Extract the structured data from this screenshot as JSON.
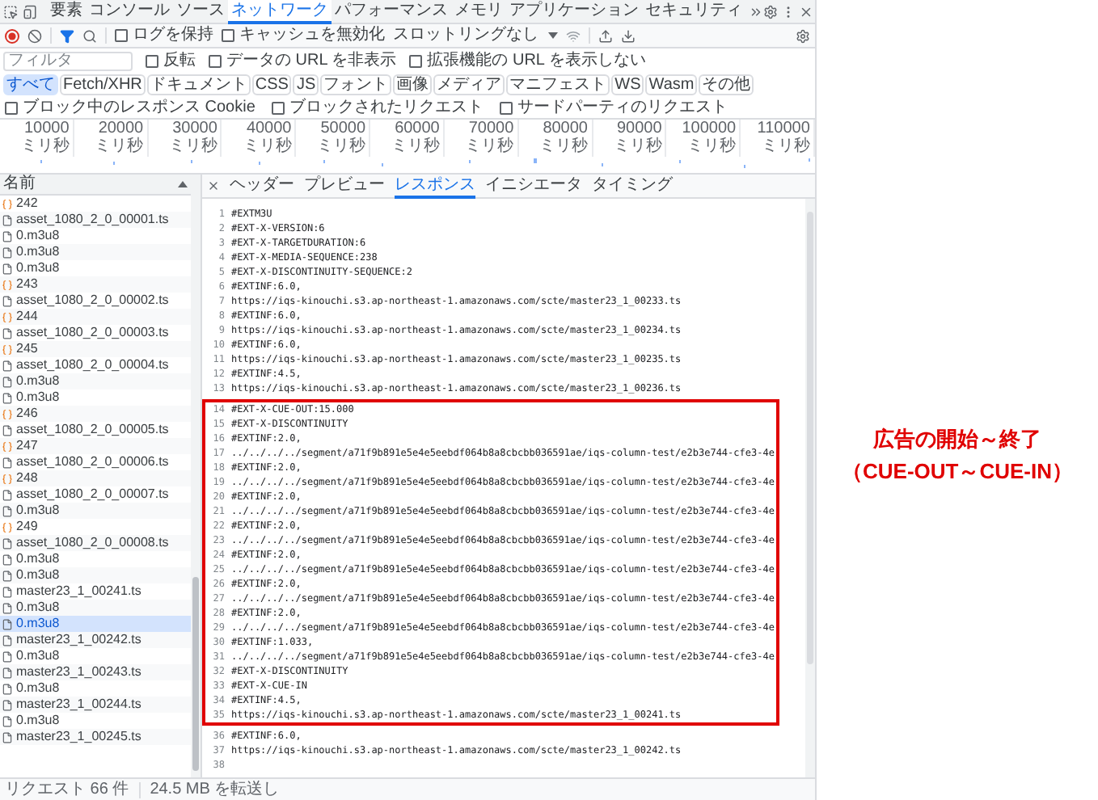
{
  "devtools_tabs": [
    {
      "label": "要素",
      "selected": false
    },
    {
      "label": "コンソール",
      "selected": false
    },
    {
      "label": "ソース",
      "selected": false
    },
    {
      "label": "ネットワーク",
      "selected": true
    },
    {
      "label": "パフォーマンス",
      "selected": false
    },
    {
      "label": "メモリ",
      "selected": false
    },
    {
      "label": "アプリケーション",
      "selected": false
    },
    {
      "label": "セキュリティ",
      "selected": false
    }
  ],
  "toolbar": {
    "checkboxes": [
      {
        "label": "ログを保持",
        "checked": false
      },
      {
        "label": "キャッシュを無効化",
        "checked": false
      }
    ],
    "throttling": "スロットリングなし"
  },
  "filter": {
    "placeholder": "フィルタ",
    "checkboxes": [
      {
        "label": "反転",
        "checked": false
      },
      {
        "label": "データの URL を非表示",
        "checked": false
      },
      {
        "label": "拡張機能の URL を表示しない",
        "checked": false
      }
    ]
  },
  "type_filters": [
    {
      "label": "すべて",
      "selected": true
    },
    {
      "label": "Fetch/XHR",
      "selected": false
    },
    {
      "label": "ドキュメント",
      "selected": false
    },
    {
      "label": "CSS",
      "selected": false
    },
    {
      "label": "JS",
      "selected": false
    },
    {
      "label": "フォント",
      "selected": false
    },
    {
      "label": "画像",
      "selected": false
    },
    {
      "label": "メディア",
      "selected": false
    },
    {
      "label": "マニフェスト",
      "selected": false
    },
    {
      "label": "WS",
      "selected": false
    },
    {
      "label": "Wasm",
      "selected": false
    },
    {
      "label": "その他",
      "selected": false
    }
  ],
  "request_checkboxes": [
    {
      "label": "ブロック中のレスポンス Cookie",
      "checked": false
    },
    {
      "label": "ブロックされたリクエスト",
      "checked": false
    },
    {
      "label": "サードパーティのリクエスト",
      "checked": false
    }
  ],
  "timeline": {
    "labels": [
      "10000 ミリ秒",
      "20000 ミリ秒",
      "30000 ミリ秒",
      "40000 ミリ秒",
      "50000 ミリ秒",
      "60000 ミリ秒",
      "70000 ミリ秒",
      "80000 ミリ秒",
      "90000 ミリ秒",
      "100000 ミリ秒",
      "110000 ミリ秒"
    ]
  },
  "requests": {
    "header": "名前",
    "items": [
      {
        "name": "242",
        "kind": "playlist",
        "selected": false
      },
      {
        "name": "asset_1080_2_0_00001.ts",
        "kind": "file",
        "selected": false
      },
      {
        "name": "0.m3u8",
        "kind": "file",
        "selected": false
      },
      {
        "name": "0.m3u8",
        "kind": "file",
        "selected": false
      },
      {
        "name": "0.m3u8",
        "kind": "file",
        "selected": false
      },
      {
        "name": "243",
        "kind": "playlist",
        "selected": false
      },
      {
        "name": "asset_1080_2_0_00002.ts",
        "kind": "file",
        "selected": false
      },
      {
        "name": "244",
        "kind": "playlist",
        "selected": false
      },
      {
        "name": "asset_1080_2_0_00003.ts",
        "kind": "file",
        "selected": false
      },
      {
        "name": "245",
        "kind": "playlist",
        "selected": false
      },
      {
        "name": "asset_1080_2_0_00004.ts",
        "kind": "file",
        "selected": false
      },
      {
        "name": "0.m3u8",
        "kind": "file",
        "selected": false
      },
      {
        "name": "0.m3u8",
        "kind": "file",
        "selected": false
      },
      {
        "name": "246",
        "kind": "playlist",
        "selected": false
      },
      {
        "name": "asset_1080_2_0_00005.ts",
        "kind": "file",
        "selected": false
      },
      {
        "name": "247",
        "kind": "playlist",
        "selected": false
      },
      {
        "name": "asset_1080_2_0_00006.ts",
        "kind": "file",
        "selected": false
      },
      {
        "name": "248",
        "kind": "playlist",
        "selected": false
      },
      {
        "name": "asset_1080_2_0_00007.ts",
        "kind": "file",
        "selected": false
      },
      {
        "name": "0.m3u8",
        "kind": "file",
        "selected": false
      },
      {
        "name": "249",
        "kind": "playlist",
        "selected": false
      },
      {
        "name": "asset_1080_2_0_00008.ts",
        "kind": "file",
        "selected": false
      },
      {
        "name": "0.m3u8",
        "kind": "file",
        "selected": false
      },
      {
        "name": "0.m3u8",
        "kind": "file",
        "selected": false
      },
      {
        "name": "master23_1_00241.ts",
        "kind": "file",
        "selected": false
      },
      {
        "name": "0.m3u8",
        "kind": "file",
        "selected": false
      },
      {
        "name": "0.m3u8",
        "kind": "file",
        "selected": true
      },
      {
        "name": "master23_1_00242.ts",
        "kind": "file",
        "selected": false
      },
      {
        "name": "0.m3u8",
        "kind": "file",
        "selected": false
      },
      {
        "name": "master23_1_00243.ts",
        "kind": "file",
        "selected": false
      },
      {
        "name": "0.m3u8",
        "kind": "file",
        "selected": false
      },
      {
        "name": "master23_1_00244.ts",
        "kind": "file",
        "selected": false
      },
      {
        "name": "0.m3u8",
        "kind": "file",
        "selected": false
      },
      {
        "name": "master23_1_00245.ts",
        "kind": "file",
        "selected": false
      }
    ]
  },
  "detail": {
    "tabs": [
      {
        "label": "ヘッダー",
        "selected": false
      },
      {
        "label": "プレビュー",
        "selected": false
      },
      {
        "label": "レスポンス",
        "selected": true
      },
      {
        "label": "イニシエータ",
        "selected": false
      },
      {
        "label": "タイミング",
        "selected": false
      }
    ],
    "blocks": [
      {
        "boxed": false,
        "lines": [
          {
            "number": "1",
            "text": "#EXTM3U"
          },
          {
            "number": "2",
            "text": "#EXT-X-VERSION:6"
          },
          {
            "number": "3",
            "text": "#EXT-X-TARGETDURATION:6"
          },
          {
            "number": "4",
            "text": "#EXT-X-MEDIA-SEQUENCE:238"
          },
          {
            "number": "5",
            "text": "#EXT-X-DISCONTINUITY-SEQUENCE:2"
          },
          {
            "number": "6",
            "text": "#EXTINF:6.0,"
          },
          {
            "number": "7",
            "text": "https://iqs-kinouchi.s3.ap-northeast-1.amazonaws.com/scte/master23_1_00233.ts"
          },
          {
            "number": "8",
            "text": "#EXTINF:6.0,"
          },
          {
            "number": "9",
            "text": "https://iqs-kinouchi.s3.ap-northeast-1.amazonaws.com/scte/master23_1_00234.ts"
          },
          {
            "number": "10",
            "text": "#EXTINF:6.0,"
          },
          {
            "number": "11",
            "text": "https://iqs-kinouchi.s3.ap-northeast-1.amazonaws.com/scte/master23_1_00235.ts"
          },
          {
            "number": "12",
            "text": "#EXTINF:4.5,"
          },
          {
            "number": "13",
            "text": "https://iqs-kinouchi.s3.ap-northeast-1.amazonaws.com/scte/master23_1_00236.ts"
          }
        ]
      },
      {
        "boxed": true,
        "lines": [
          {
            "number": "14",
            "text": "#EXT-X-CUE-OUT:15.000"
          },
          {
            "number": "15",
            "text": "#EXT-X-DISCONTINUITY"
          },
          {
            "number": "16",
            "text": "#EXTINF:2.0,"
          },
          {
            "number": "17",
            "text": "../../../../segment/a71f9b891e5e4e5eebdf064b8a8cbcbb036591ae/iqs-column-test/e2b3e744-cfe3-4e"
          },
          {
            "number": "18",
            "text": "#EXTINF:2.0,"
          },
          {
            "number": "19",
            "text": "../../../../segment/a71f9b891e5e4e5eebdf064b8a8cbcbb036591ae/iqs-column-test/e2b3e744-cfe3-4e"
          },
          {
            "number": "20",
            "text": "#EXTINF:2.0,"
          },
          {
            "number": "21",
            "text": "../../../../segment/a71f9b891e5e4e5eebdf064b8a8cbcbb036591ae/iqs-column-test/e2b3e744-cfe3-4e"
          },
          {
            "number": "22",
            "text": "#EXTINF:2.0,"
          },
          {
            "number": "23",
            "text": "../../../../segment/a71f9b891e5e4e5eebdf064b8a8cbcbb036591ae/iqs-column-test/e2b3e744-cfe3-4e"
          },
          {
            "number": "24",
            "text": "#EXTINF:2.0,"
          },
          {
            "number": "25",
            "text": "../../../../segment/a71f9b891e5e4e5eebdf064b8a8cbcbb036591ae/iqs-column-test/e2b3e744-cfe3-4e"
          },
          {
            "number": "26",
            "text": "#EXTINF:2.0,"
          },
          {
            "number": "27",
            "text": "../../../../segment/a71f9b891e5e4e5eebdf064b8a8cbcbb036591ae/iqs-column-test/e2b3e744-cfe3-4e"
          },
          {
            "number": "28",
            "text": "#EXTINF:2.0,"
          },
          {
            "number": "29",
            "text": "../../../../segment/a71f9b891e5e4e5eebdf064b8a8cbcbb036591ae/iqs-column-test/e2b3e744-cfe3-4e"
          },
          {
            "number": "30",
            "text": "#EXTINF:1.033,"
          },
          {
            "number": "31",
            "text": "../../../../segment/a71f9b891e5e4e5eebdf064b8a8cbcbb036591ae/iqs-column-test/e2b3e744-cfe3-4e"
          },
          {
            "number": "32",
            "text": "#EXT-X-DISCONTINUITY"
          },
          {
            "number": "33",
            "text": "#EXT-X-CUE-IN"
          },
          {
            "number": "34",
            "text": "#EXTINF:4.5,"
          },
          {
            "number": "35",
            "text": "https://iqs-kinouchi.s3.ap-northeast-1.amazonaws.com/scte/master23_1_00241.ts"
          }
        ]
      },
      {
        "boxed": false,
        "lines": [
          {
            "number": "36",
            "text": "#EXTINF:6.0,"
          },
          {
            "number": "37",
            "text": "https://iqs-kinouchi.s3.ap-northeast-1.amazonaws.com/scte/master23_1_00242.ts"
          },
          {
            "number": "38"
          }
        ]
      }
    ]
  },
  "status_bar": {
    "count": "リクエスト 66 件",
    "transferred": "24.5 MB を転送し"
  },
  "annotation": {
    "lines": [
      "広告の開始～終了",
      "（CUE-OUT～CUE-IN）"
    ]
  }
}
